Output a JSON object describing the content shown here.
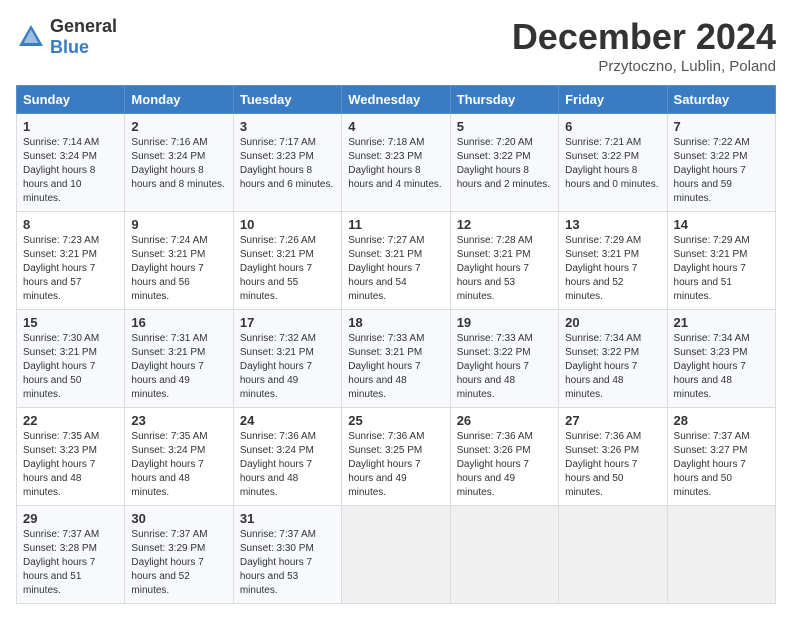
{
  "header": {
    "logo_general": "General",
    "logo_blue": "Blue",
    "month_title": "December 2024",
    "location": "Przytoczno, Lublin, Poland"
  },
  "days_of_week": [
    "Sunday",
    "Monday",
    "Tuesday",
    "Wednesday",
    "Thursday",
    "Friday",
    "Saturday"
  ],
  "weeks": [
    [
      {
        "day": "1",
        "sunrise": "7:14 AM",
        "sunset": "3:24 PM",
        "daylight": "8 hours and 10 minutes."
      },
      {
        "day": "2",
        "sunrise": "7:16 AM",
        "sunset": "3:24 PM",
        "daylight": "8 hours and 8 minutes."
      },
      {
        "day": "3",
        "sunrise": "7:17 AM",
        "sunset": "3:23 PM",
        "daylight": "8 hours and 6 minutes."
      },
      {
        "day": "4",
        "sunrise": "7:18 AM",
        "sunset": "3:23 PM",
        "daylight": "8 hours and 4 minutes."
      },
      {
        "day": "5",
        "sunrise": "7:20 AM",
        "sunset": "3:22 PM",
        "daylight": "8 hours and 2 minutes."
      },
      {
        "day": "6",
        "sunrise": "7:21 AM",
        "sunset": "3:22 PM",
        "daylight": "8 hours and 0 minutes."
      },
      {
        "day": "7",
        "sunrise": "7:22 AM",
        "sunset": "3:22 PM",
        "daylight": "7 hours and 59 minutes."
      }
    ],
    [
      {
        "day": "8",
        "sunrise": "7:23 AM",
        "sunset": "3:21 PM",
        "daylight": "7 hours and 57 minutes."
      },
      {
        "day": "9",
        "sunrise": "7:24 AM",
        "sunset": "3:21 PM",
        "daylight": "7 hours and 56 minutes."
      },
      {
        "day": "10",
        "sunrise": "7:26 AM",
        "sunset": "3:21 PM",
        "daylight": "7 hours and 55 minutes."
      },
      {
        "day": "11",
        "sunrise": "7:27 AM",
        "sunset": "3:21 PM",
        "daylight": "7 hours and 54 minutes."
      },
      {
        "day": "12",
        "sunrise": "7:28 AM",
        "sunset": "3:21 PM",
        "daylight": "7 hours and 53 minutes."
      },
      {
        "day": "13",
        "sunrise": "7:29 AM",
        "sunset": "3:21 PM",
        "daylight": "7 hours and 52 minutes."
      },
      {
        "day": "14",
        "sunrise": "7:29 AM",
        "sunset": "3:21 PM",
        "daylight": "7 hours and 51 minutes."
      }
    ],
    [
      {
        "day": "15",
        "sunrise": "7:30 AM",
        "sunset": "3:21 PM",
        "daylight": "7 hours and 50 minutes."
      },
      {
        "day": "16",
        "sunrise": "7:31 AM",
        "sunset": "3:21 PM",
        "daylight": "7 hours and 49 minutes."
      },
      {
        "day": "17",
        "sunrise": "7:32 AM",
        "sunset": "3:21 PM",
        "daylight": "7 hours and 49 minutes."
      },
      {
        "day": "18",
        "sunrise": "7:33 AM",
        "sunset": "3:21 PM",
        "daylight": "7 hours and 48 minutes."
      },
      {
        "day": "19",
        "sunrise": "7:33 AM",
        "sunset": "3:22 PM",
        "daylight": "7 hours and 48 minutes."
      },
      {
        "day": "20",
        "sunrise": "7:34 AM",
        "sunset": "3:22 PM",
        "daylight": "7 hours and 48 minutes."
      },
      {
        "day": "21",
        "sunrise": "7:34 AM",
        "sunset": "3:23 PM",
        "daylight": "7 hours and 48 minutes."
      }
    ],
    [
      {
        "day": "22",
        "sunrise": "7:35 AM",
        "sunset": "3:23 PM",
        "daylight": "7 hours and 48 minutes."
      },
      {
        "day": "23",
        "sunrise": "7:35 AM",
        "sunset": "3:24 PM",
        "daylight": "7 hours and 48 minutes."
      },
      {
        "day": "24",
        "sunrise": "7:36 AM",
        "sunset": "3:24 PM",
        "daylight": "7 hours and 48 minutes."
      },
      {
        "day": "25",
        "sunrise": "7:36 AM",
        "sunset": "3:25 PM",
        "daylight": "7 hours and 49 minutes."
      },
      {
        "day": "26",
        "sunrise": "7:36 AM",
        "sunset": "3:26 PM",
        "daylight": "7 hours and 49 minutes."
      },
      {
        "day": "27",
        "sunrise": "7:36 AM",
        "sunset": "3:26 PM",
        "daylight": "7 hours and 50 minutes."
      },
      {
        "day": "28",
        "sunrise": "7:37 AM",
        "sunset": "3:27 PM",
        "daylight": "7 hours and 50 minutes."
      }
    ],
    [
      {
        "day": "29",
        "sunrise": "7:37 AM",
        "sunset": "3:28 PM",
        "daylight": "7 hours and 51 minutes."
      },
      {
        "day": "30",
        "sunrise": "7:37 AM",
        "sunset": "3:29 PM",
        "daylight": "7 hours and 52 minutes."
      },
      {
        "day": "31",
        "sunrise": "7:37 AM",
        "sunset": "3:30 PM",
        "daylight": "7 hours and 53 minutes."
      },
      null,
      null,
      null,
      null
    ]
  ]
}
